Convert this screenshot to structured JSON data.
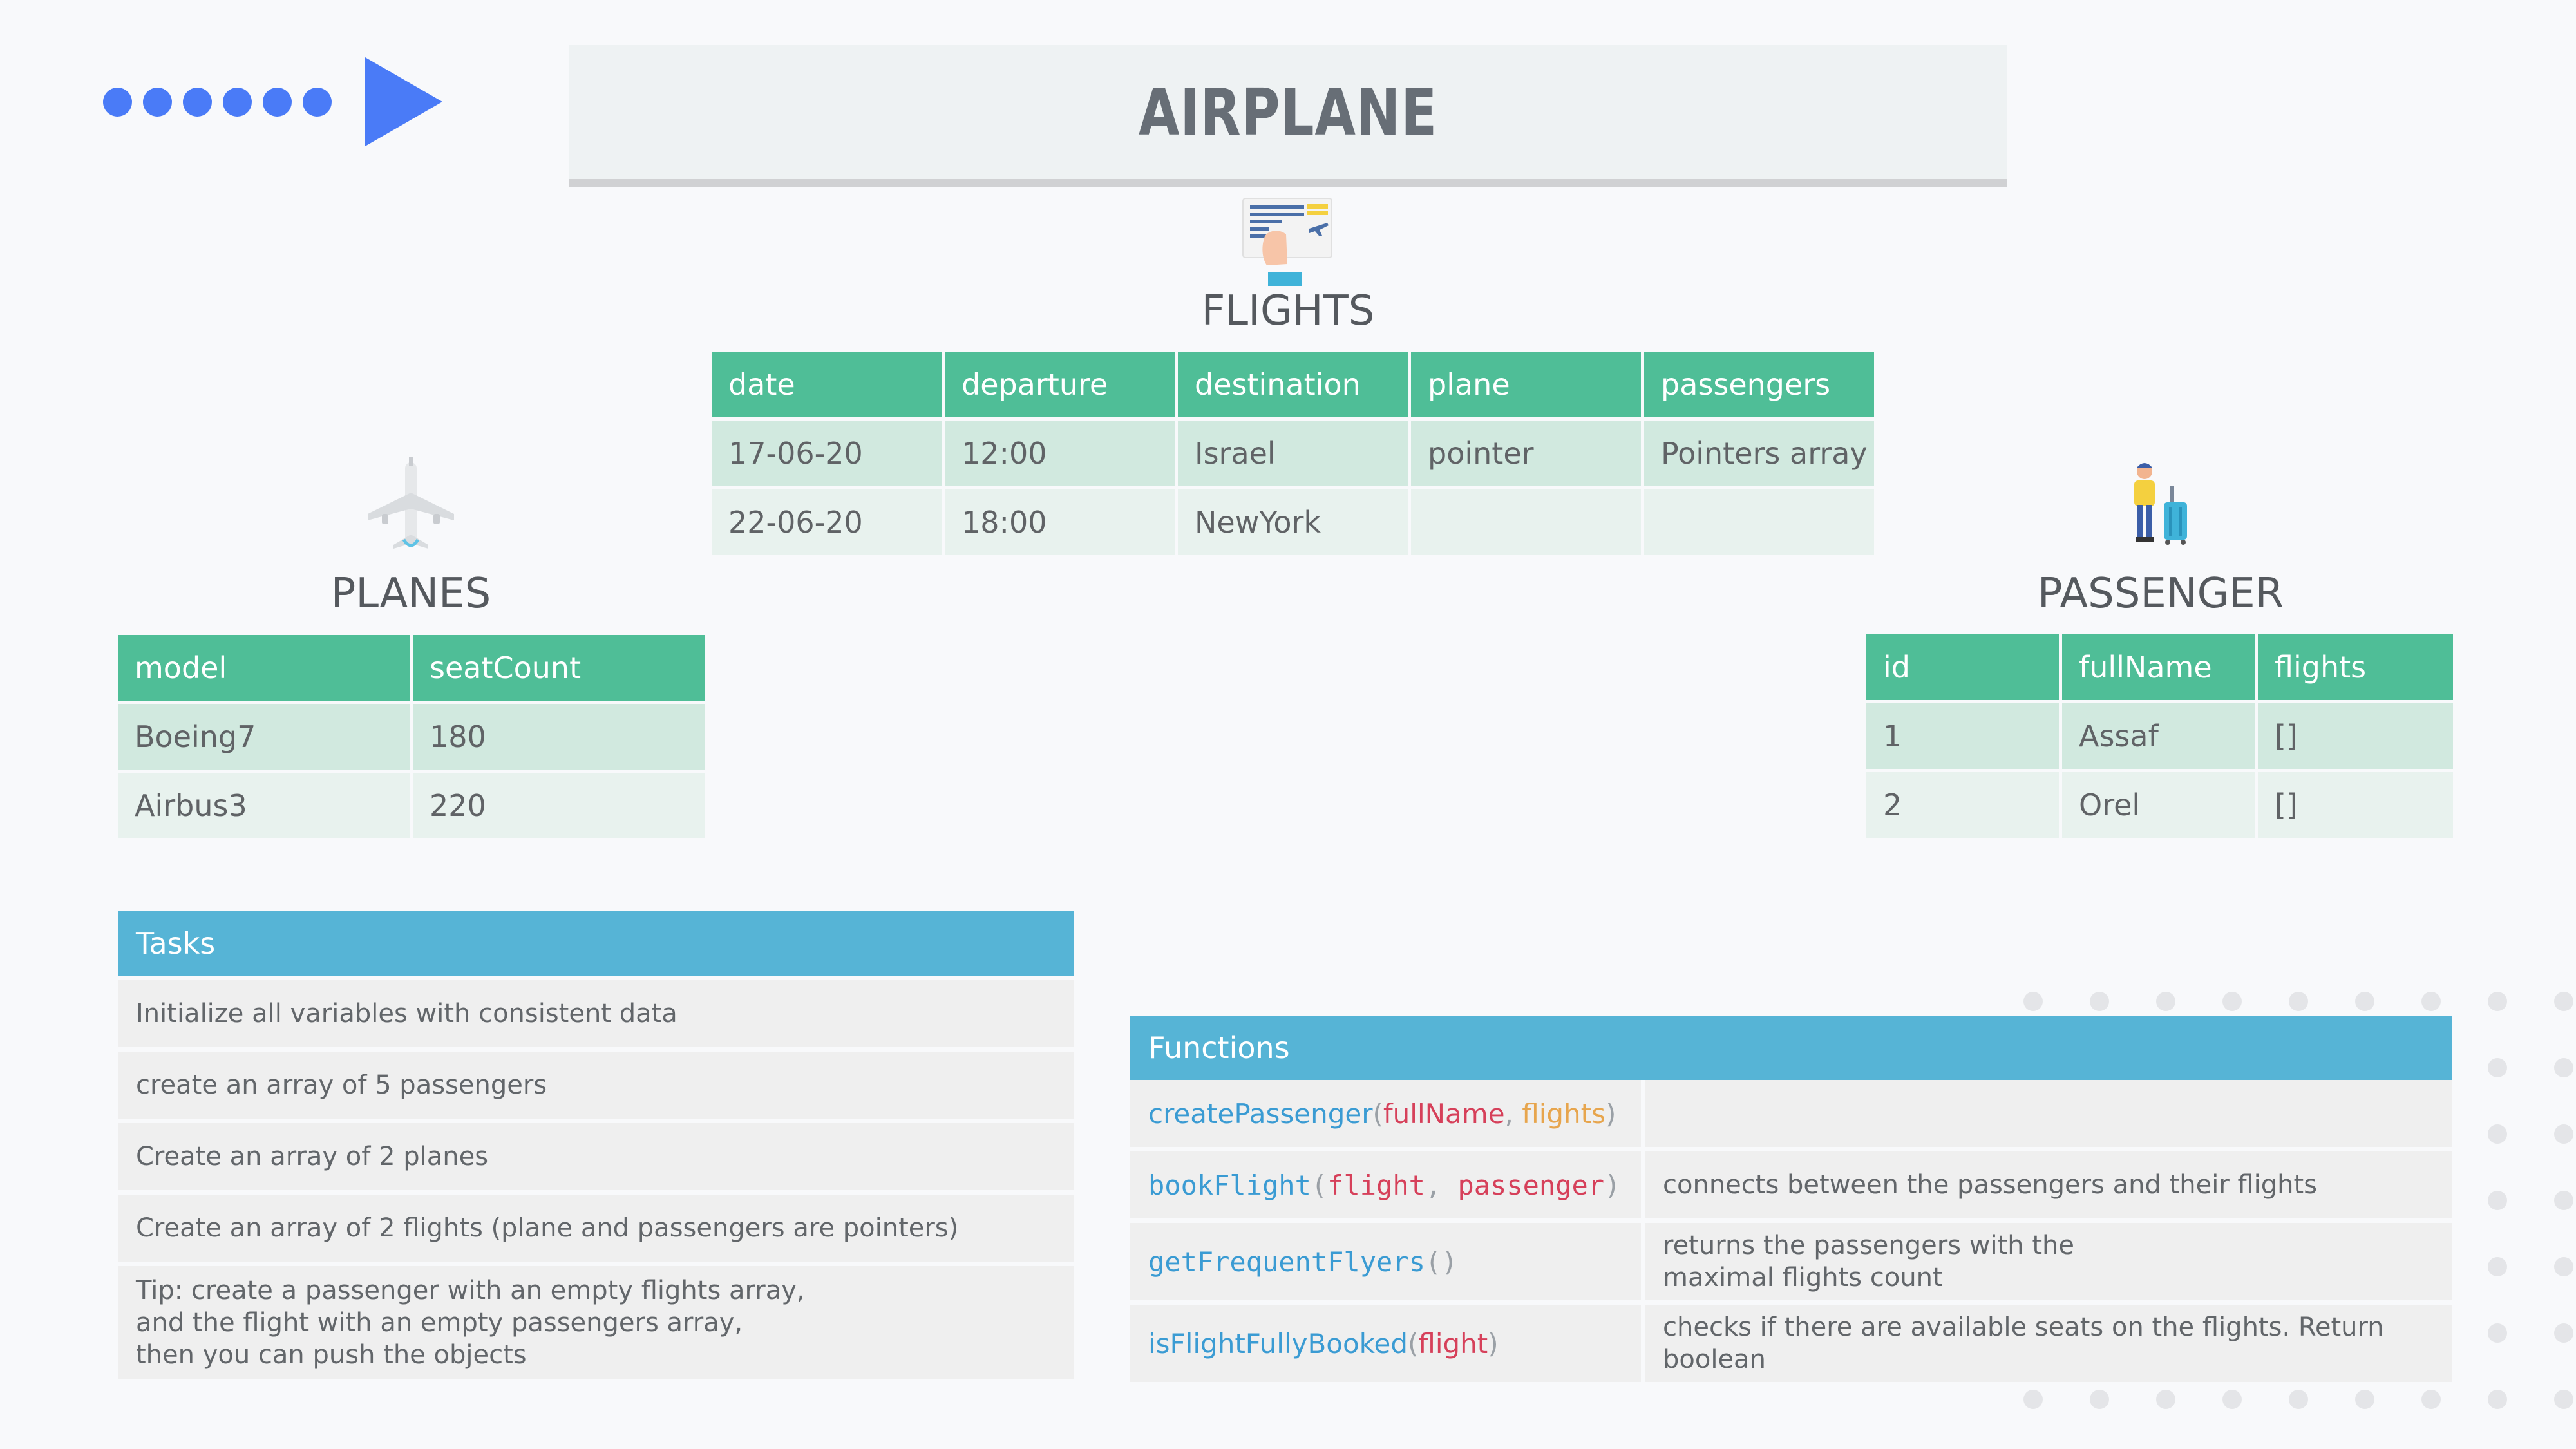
{
  "title": "AIRPLANE",
  "icons": {
    "flights": "boarding-pass-icon",
    "planes": "airplane-icon",
    "passenger": "traveler-with-luggage-icon"
  },
  "colors": {
    "accent_blue": "#4a7bf7",
    "table_header_green": "#4fbe97",
    "panel_header_blue": "#56b4d6"
  },
  "flights": {
    "heading": "FLIGHTS",
    "columns": [
      "date",
      "departure",
      "destination",
      "plane",
      "passengers"
    ],
    "rows": [
      [
        "17-06-20",
        "12:00",
        "Israel",
        "pointer",
        "Pointers array"
      ],
      [
        "22-06-20",
        "18:00",
        "NewYork",
        "",
        ""
      ]
    ]
  },
  "planes": {
    "heading": "PLANES",
    "columns": [
      "model",
      "seatCount"
    ],
    "rows": [
      [
        "Boeing7",
        "180"
      ],
      [
        "Airbus3",
        "220"
      ]
    ]
  },
  "passenger": {
    "heading": "PASSENGER",
    "columns": [
      "id",
      "fullName",
      "flights"
    ],
    "rows": [
      [
        "1",
        "Assaf",
        "[]"
      ],
      [
        "2",
        "Orel",
        "[]"
      ]
    ]
  },
  "tasks": {
    "heading": "Tasks",
    "items": [
      "Initialize all variables with consistent data",
      "create an array of 5 passengers",
      "Create an array of 2 planes",
      "Create an array of 2 flights (plane and passengers are pointers)",
      "Tip: create a passenger with an empty flights array,\nand the flight with an empty passengers array,\nthen you can push the objects"
    ]
  },
  "functions": {
    "heading": "Functions",
    "items": [
      {
        "name": "createPassenger",
        "params": [
          "fullName",
          "flights"
        ],
        "description": ""
      },
      {
        "name": "bookFlight",
        "params": [
          "flight",
          "passenger"
        ],
        "description": "connects between the passengers and their flights"
      },
      {
        "name": "getFrequentFlyers",
        "params": [],
        "description": "returns the passengers with the\nmaximal flights count"
      },
      {
        "name": "isFlightFullyBooked",
        "params": [
          "flight"
        ],
        "description": "checks if there are available seats on the flights. Return\nboolean"
      }
    ]
  }
}
